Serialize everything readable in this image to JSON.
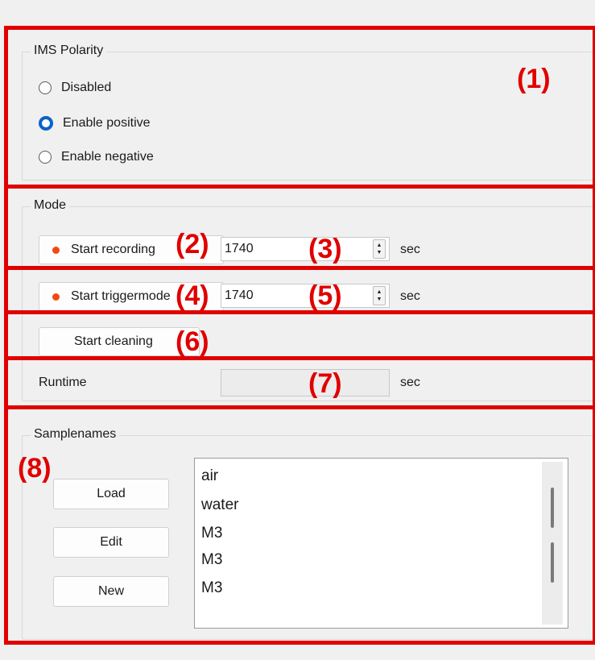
{
  "polarity": {
    "title": "IMS Polarity",
    "options": [
      {
        "label": "Disabled",
        "selected": false
      },
      {
        "label": "Enable positive",
        "selected": true
      },
      {
        "label": "Enable negative",
        "selected": false
      }
    ]
  },
  "mode": {
    "title": "Mode",
    "recording_label": "Start recording",
    "recording_value": "1740",
    "trigger_label": "Start triggermode",
    "trigger_value": "1740",
    "cleaning_label": "Start cleaning",
    "unit": "sec",
    "runtime_label": "Runtime",
    "runtime_value": ""
  },
  "samplenames": {
    "title": "Samplenames",
    "load_label": "Load",
    "edit_label": "Edit",
    "new_label": "New",
    "items": [
      "air",
      "water",
      "M3",
      "M3",
      "M3"
    ]
  },
  "annotations": [
    "(1)",
    "(2)",
    "(3)",
    "(4)",
    "(5)",
    "(6)",
    "(7)",
    "(8)"
  ],
  "colors": {
    "annotation": "#e00000",
    "radio_selected": "#0a63c9",
    "record_dot": "#f04a12"
  }
}
